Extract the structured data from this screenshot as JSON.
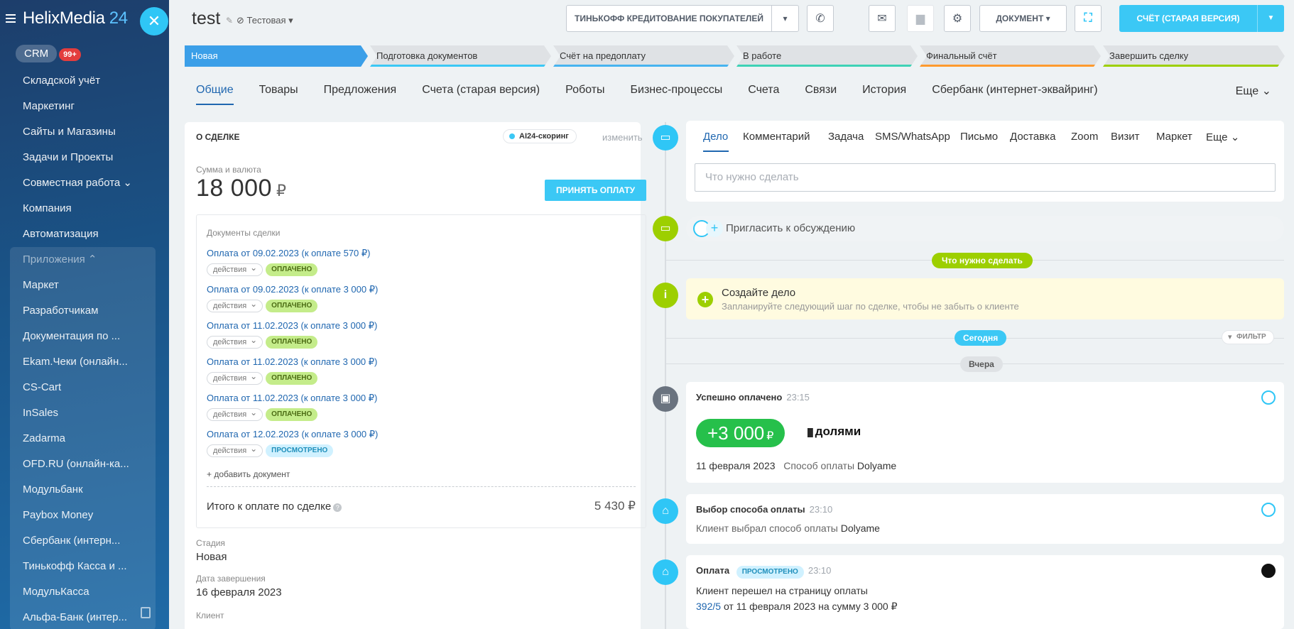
{
  "sidebar": {
    "logo_main": "HelixMedia",
    "logo_num": "24",
    "crm_label": "CRM",
    "crm_badge": "99+",
    "items": [
      "Складской учёт",
      "Маркетинг",
      "Сайты и Магазины",
      "Задачи и Проекты",
      "Совместная работа ⌄",
      "Компания",
      "Автоматизация"
    ],
    "apps_head": "Приложения ⌃",
    "apps": [
      "Маркет",
      "Разработчикам",
      "Документация по ...",
      "Ekam.Чеки (онлайн...",
      "CS-Cart",
      "InSales",
      "Zadarma",
      "OFD.RU (онлайн-ка...",
      "Модульбанк",
      "Paybox Money",
      "Сбербанк (интерн...",
      "Тинькофф Касса и ...",
      "МодульКасса",
      "Альфа-Банк (интер..."
    ]
  },
  "header": {
    "title": "test",
    "category": "Тестовая",
    "tinkoff_btn": "Тинькофф кредитование покупателей",
    "document_btn": "Документ",
    "invoice_btn": "Счёт (старая версия)"
  },
  "stages": [
    {
      "label": "Новая",
      "color": "#3b9fe8",
      "bar": "#3b9fe8",
      "active": true
    },
    {
      "label": "Подготовка документов",
      "color": "#dfe2e5",
      "bar": "#3bc8f5"
    },
    {
      "label": "Счёт на предоплату",
      "color": "#dfe2e5",
      "bar": "#47b4f0"
    },
    {
      "label": "В работе",
      "color": "#dfe2e5",
      "bar": "#3ed2b6"
    },
    {
      "label": "Финальный счёт",
      "color": "#dfe2e5",
      "bar": "#ff9a2e"
    },
    {
      "label": "Завершить сделку",
      "color": "#dfe2e5",
      "bar": "#9dcf00"
    }
  ],
  "tabs": [
    "Общие",
    "Товары",
    "Предложения",
    "Счета (старая версия)",
    "Роботы",
    "Бизнес-процессы",
    "Счета",
    "Связи",
    "История",
    "Сбербанк (интернет-эквайринг)"
  ],
  "tabs_more": "Еще ⌄",
  "deal": {
    "section_title": "О сделке",
    "ai_scoring": "AI24-скоринг",
    "change": "изменить",
    "sum_label": "Сумма и валюта",
    "sum_value": "18 000",
    "sum_currency": "₽",
    "accept_payment": "Принять оплату",
    "docs_title": "Документы сделки",
    "documents": [
      {
        "link": "Оплата от 09.02.2023 (к оплате 570 ₽)",
        "actions": "действия",
        "status": "оплачено",
        "status_type": "paid"
      },
      {
        "link": "Оплата от 09.02.2023 (к оплате 3 000 ₽)",
        "actions": "действия",
        "status": "оплачено",
        "status_type": "paid"
      },
      {
        "link": "Оплата от 11.02.2023 (к оплате 3 000 ₽)",
        "actions": "действия",
        "status": "оплачено",
        "status_type": "paid"
      },
      {
        "link": "Оплата от 11.02.2023 (к оплате 3 000 ₽)",
        "actions": "действия",
        "status": "оплачено",
        "status_type": "paid"
      },
      {
        "link": "Оплата от 11.02.2023 (к оплате 3 000 ₽)",
        "actions": "действия",
        "status": "оплачено",
        "status_type": "paid"
      },
      {
        "link": "Оплата от 12.02.2023 (к оплате 3 000 ₽)",
        "actions": "действия",
        "status": "просмотрено",
        "status_type": "viewed"
      }
    ],
    "add_document": "+ добавить документ",
    "total_label": "Итого к оплате по сделке",
    "total_value": "5 430 ₽",
    "stage_label": "Стадия",
    "stage_value": "Новая",
    "close_date_label": "Дата завершения",
    "close_date_value": "16 февраля 2023",
    "client_label": "Клиент"
  },
  "timeline": {
    "compose_tabs": [
      "Дело",
      "Комментарий",
      "Задача",
      "SMS/WhatsApp",
      "Письмо",
      "Доставка",
      "Zoom",
      "Визит",
      "Маркет",
      "Еще ⌄"
    ],
    "compose_placeholder": "Что нужно сделать",
    "invite": "Пригласить к обсуждению",
    "todo_chip": "Что нужно сделать",
    "todo_title": "Создайте дело",
    "todo_sub": "Запланируйте следующий шаг по сделке, чтобы не забыть о клиенте",
    "today": "Сегодня",
    "filter": "Фильтр",
    "yesterday": "Вчера",
    "ev1_title": "Успешно оплачено",
    "ev1_time": "23:15",
    "ev1_sum": "+3 000",
    "ev1_cur": "₽",
    "ev1_brand": "долями",
    "ev1_date": "11 февраля 2023",
    "ev1_method_label": "Способ оплаты",
    "ev1_method": "Dolyame",
    "ev2_title": "Выбор способа оплаты",
    "ev2_time": "23:10",
    "ev2_text": "Клиент выбрал способ оплаты",
    "ev2_method": "Dolyame",
    "ev3_title": "Оплата",
    "ev3_badge": "просмотрено",
    "ev3_time": "23:10",
    "ev3_text": "Клиент перешел на страницу оплаты",
    "ev3_link": "392/5",
    "ev3_rest": "от 11 февраля 2023 на сумму 3 000 ₽"
  }
}
